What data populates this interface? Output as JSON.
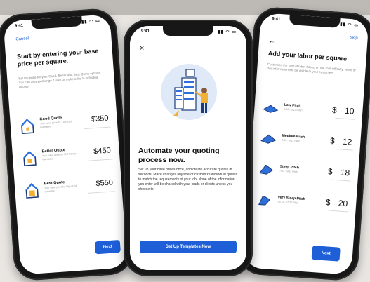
{
  "phone1": {
    "time": "9:41",
    "cancel": "Cancel",
    "title": "Start by entering your base price per square.",
    "subtitle": "Set the price for your Good, Better and Best Quote options. You can always change it later or make edits to individual quotes.",
    "quotes": [
      {
        "name": "Good Quote",
        "desc": "Your base price for Low End estimates",
        "price": "$350"
      },
      {
        "name": "Better Quote",
        "desc": "Your base price for Mid-Range estimates",
        "price": "$450"
      },
      {
        "name": "Best Quote",
        "desc": "Your base price for High End estimates",
        "price": "$550"
      }
    ],
    "next_label": "Next"
  },
  "phone2": {
    "time": "9:41",
    "close": "×",
    "title": "Automate your quoting process now.",
    "body": "Set up your base prices once, and create accurate quotes in seconds. Make changes anytime or customize individual quotes to match the requirements of your job. None of the information you enter will be shared with your leads or clients unless you choose to.",
    "button_label": "Set Up Templates Now"
  },
  "phone3": {
    "time": "9:41",
    "skip": "Skip",
    "back": "←",
    "title": "Add your labor per square",
    "subtitle": "Customize the cost of labor based on the roof difficulty. None of this information will be visible to your customers.",
    "pitches": [
      {
        "name": "Low Pitch",
        "desc": "1/12 - 3/12 Pitch",
        "currency": "$",
        "value": "10"
      },
      {
        "name": "Medium Pitch",
        "desc": "4/12 - 6/12 Pitch",
        "currency": "$",
        "value": "12"
      },
      {
        "name": "Steep Pitch",
        "desc": "7/12 - 9/12 Pitch",
        "currency": "$",
        "value": "18"
      },
      {
        "name": "Very Steep Pitch",
        "desc": "10/12 - 12/12 Pitch",
        "currency": "$",
        "value": "20"
      }
    ],
    "next_label": "Next"
  },
  "colors": {
    "accent": "#1e5fd8",
    "text": "#111111",
    "muted": "#8a8a8a"
  }
}
